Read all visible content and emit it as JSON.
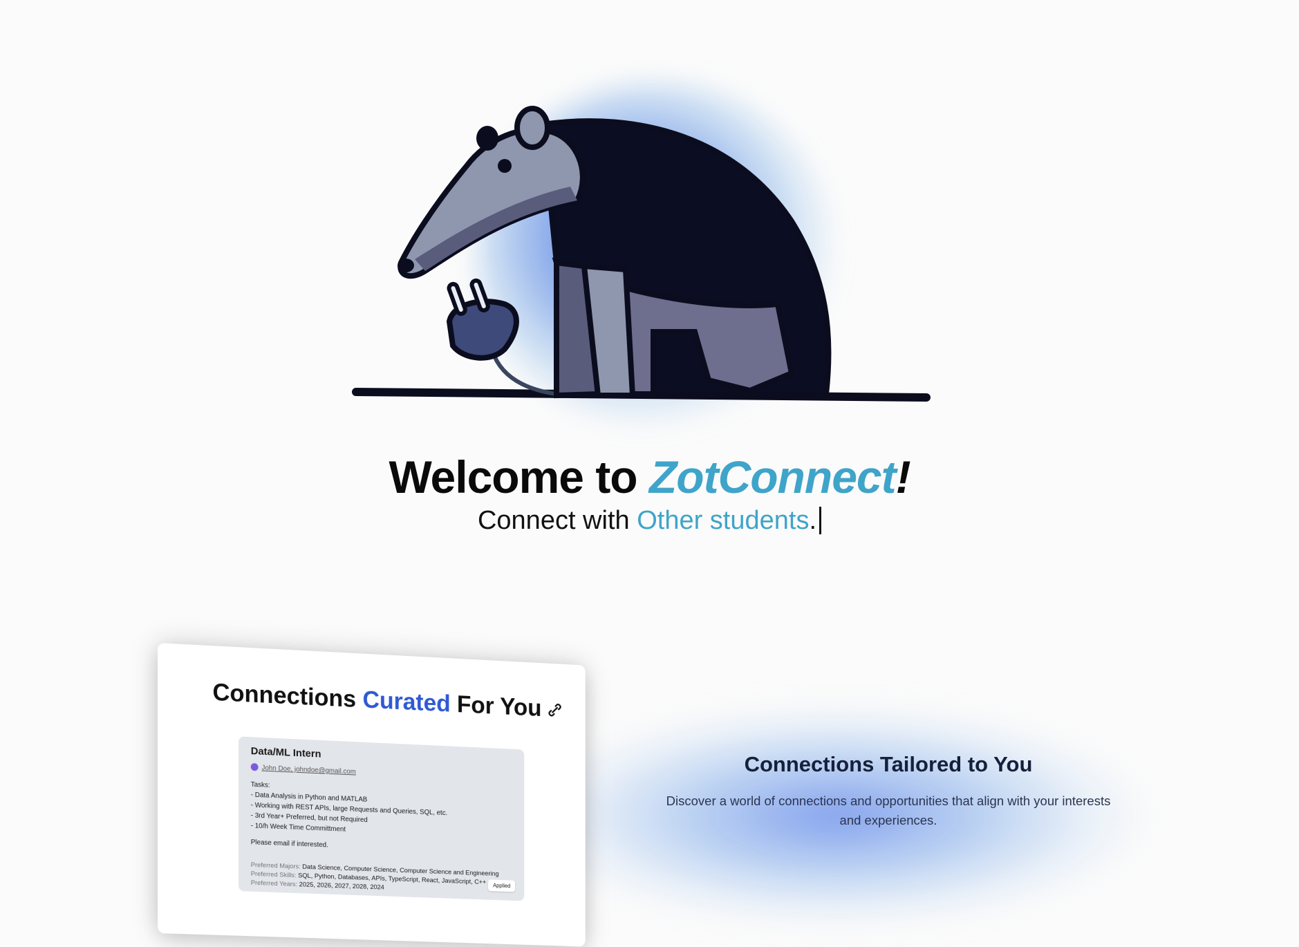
{
  "hero": {
    "welcome_prefix": "Welcome to ",
    "brand": "ZotConnect",
    "bang": "!",
    "tagline_prefix": "Connect with ",
    "tagline_highlight": "Other students",
    "tagline_suffix": "."
  },
  "preview_card": {
    "title_part1": "Connections ",
    "title_part2": "Curated",
    "title_part3": " For You",
    "icon": "link-icon",
    "job": {
      "title": "Data/ML Intern",
      "poster": "John Doe, johndoe@gmail.com",
      "tasks_label": "Tasks:",
      "tasks": [
        "- Data Analysis in Python and MATLAB",
        "- Working with REST APIs, large Requests and Queries, SQL, etc.",
        "- 3rd Year+ Preferred, but not Required",
        "- 10/h Week Time Committment"
      ],
      "note": "Please email if interested.",
      "majors_label": "Preferred Majors:",
      "majors": "Data Science, Computer Science, Computer Science and Engineering",
      "skills_label": "Preferred Skills:",
      "skills": "SQL, Python, Databases, APIs, TypeScript, React, JavaScript, C++",
      "years_label": "Preferred Years:",
      "years": "2025, 2026, 2027, 2028, 2024",
      "status": "Applied"
    }
  },
  "feature": {
    "title": "Connections Tailored to You",
    "description": "Discover a world of connections and opportunities that align with your interests and experiences."
  },
  "colors": {
    "brand_teal": "#3fa4c9",
    "curated_blue": "#2f59d4",
    "glow_blue": "#567dea"
  }
}
